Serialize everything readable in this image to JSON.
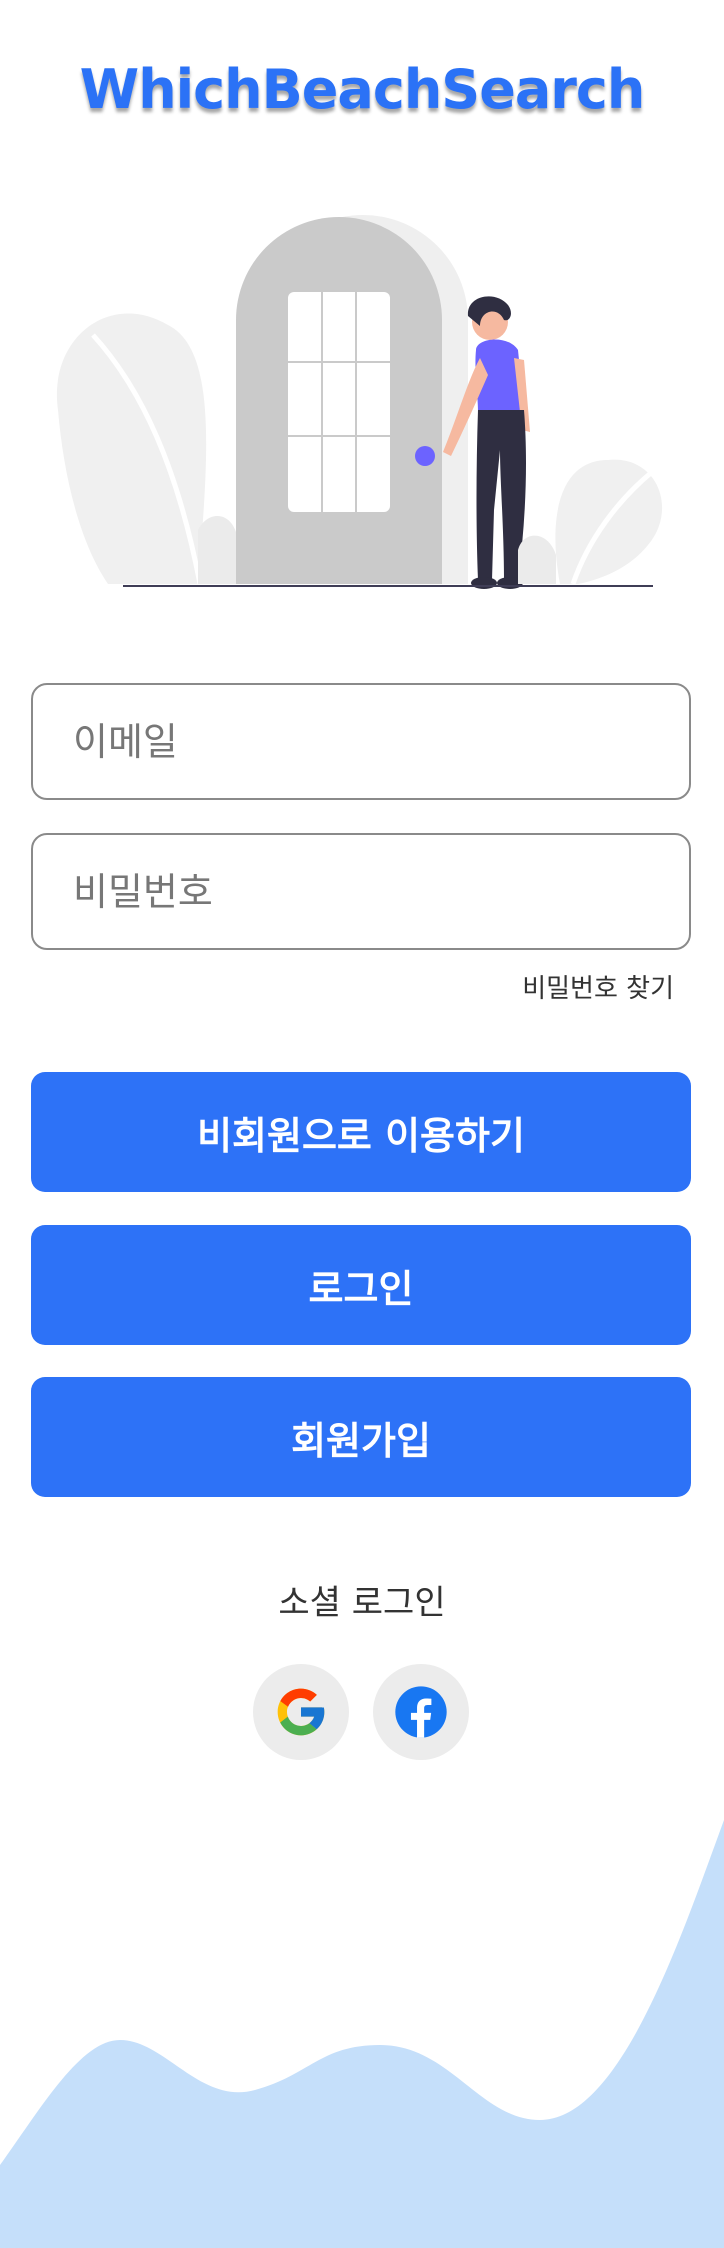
{
  "app": {
    "title": "WhichBeachSearch"
  },
  "login_form": {
    "email_placeholder": "이메일",
    "password_placeholder": "비밀번호",
    "find_password_label": "비밀번호 찾기"
  },
  "actions": {
    "guest_label": "비회원으로 이용하기",
    "login_label": "로그인",
    "signup_label": "회원가입"
  },
  "social": {
    "label": "소셜 로그인",
    "providers": [
      {
        "name": "Google",
        "icon": "google-icon"
      },
      {
        "name": "Facebook",
        "icon": "facebook-icon"
      }
    ]
  },
  "colors": {
    "brand": "#2b72f6",
    "button": "#2d72f7",
    "wave": "#c5dffa",
    "figure_shirt": "#6c63ff"
  }
}
